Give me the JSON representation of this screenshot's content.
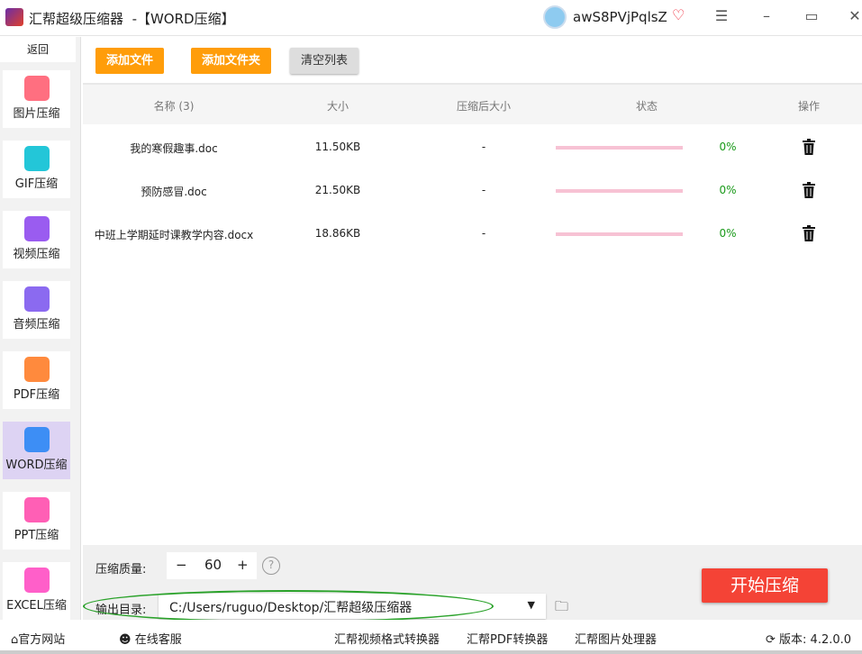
{
  "titlebar": {
    "app": "汇帮超级压缩器",
    "mode": "-【WORD压缩】",
    "username": "awS8PVjPqlsZ"
  },
  "sidebar": {
    "back": "返回",
    "items": [
      {
        "label": "图片压缩",
        "color": "#ff6f80"
      },
      {
        "label": "GIF压缩",
        "color": "#23c6d8"
      },
      {
        "label": "视频压缩",
        "color": "#9a5cf0"
      },
      {
        "label": "音频压缩",
        "color": "#8b6af0"
      },
      {
        "label": "PDF压缩",
        "color": "#ff8a3d"
      },
      {
        "label": "WORD压缩",
        "color": "#3d8ef5"
      },
      {
        "label": "PPT压缩",
        "color": "#ff5fb5"
      },
      {
        "label": "EXCEL压缩",
        "color": "#ff5fc9"
      }
    ]
  },
  "toolbar": {
    "add_file": "添加文件",
    "add_folder": "添加文件夹",
    "clear": "清空列表"
  },
  "table": {
    "headers": [
      "名称 (3)",
      "大小",
      "压缩后大小",
      "状态",
      "操作"
    ],
    "rows": [
      {
        "name": "我的寒假趣事.doc",
        "size": "11.50KB",
        "after": "-",
        "progress": "0%"
      },
      {
        "name": "预防感冒.doc",
        "size": "21.50KB",
        "after": "-",
        "progress": "0%"
      },
      {
        "name": "中班上学期延时课教学内容.docx",
        "size": "18.86KB",
        "after": "-",
        "progress": "0%"
      }
    ]
  },
  "settings": {
    "quality_label": "压缩质量:",
    "quality": "60",
    "minus": "−",
    "plus": "+",
    "help": "?",
    "output_label": "输出目录:",
    "output_path": "C:/Users/ruguo/Desktop/汇帮超级压缩器",
    "start": "开始压缩"
  },
  "footer": {
    "website": "官方网站",
    "support": "在线客服",
    "links": [
      "汇帮视频格式转换器",
      "汇帮PDF转换器",
      "汇帮图片处理器"
    ],
    "version": "版本: 4.2.0.0"
  }
}
